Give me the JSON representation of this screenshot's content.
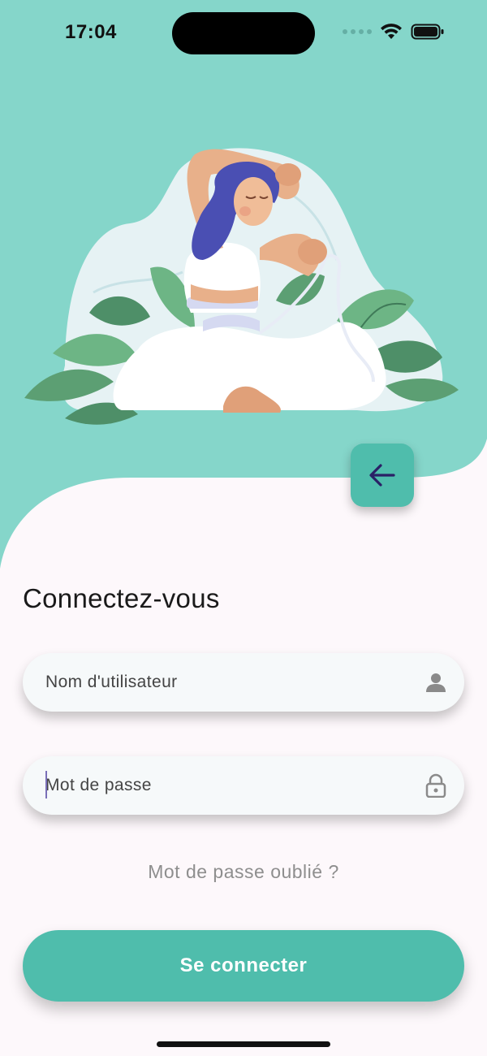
{
  "status_bar": {
    "time": "17:04"
  },
  "colors": {
    "header_teal": "#85d6ca",
    "accent_teal": "#4fbdac",
    "back_arrow": "#2a2066",
    "page_background": "#fdf8fb"
  },
  "header": {
    "back_icon": "arrow-left-icon"
  },
  "login": {
    "title": "Connectez-vous",
    "username_placeholder": "Nom d'utilisateur",
    "username_icon": "person-icon",
    "password_placeholder": "Mot de passe",
    "password_icon": "lock-icon",
    "forgot_password": "Mot de passe oublié ?",
    "submit_label": "Se connecter"
  }
}
